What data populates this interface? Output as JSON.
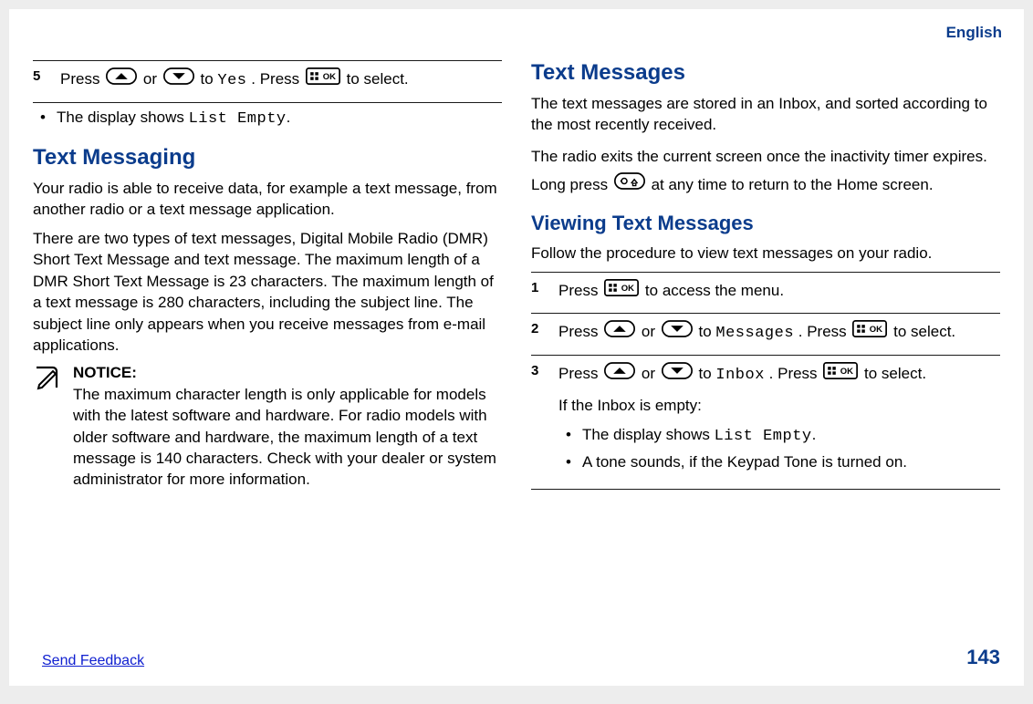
{
  "lang": "English",
  "footer": {
    "feedback": "Send Feedback",
    "page": "143"
  },
  "left": {
    "step5": {
      "num": "5",
      "t1": "Press ",
      "t2": " or ",
      "t3": " to ",
      "yes": "Yes",
      "t4": ". Press ",
      "t5": " to select."
    },
    "bullet1_a": "The display shows ",
    "bullet1_code": "List Empty",
    "bullet1_b": ".",
    "h2": "Text Messaging",
    "p1": "Your radio is able to receive data, for example a text message, from another radio or a text message application.",
    "p2": "There are two types of text messages, Digital Mobile Radio (DMR) Short Text Message and text message. The maximum length of a DMR Short Text Message is 23 characters. The maximum length of a text message is 280 characters, including the subject line. The subject line only appears when you receive messages from e-mail applications.",
    "notice_title": "NOTICE:",
    "notice_body": "The maximum character length is only applicable for models with the latest software and hardware. For radio models with older software and hardware, the maximum length of a text message is 140 characters. Check with your dealer or system administrator for more information."
  },
  "right": {
    "h2": "Text Messages",
    "p1": "The text messages are stored in an Inbox, and sorted according to the most recently received.",
    "p2a": "The radio exits the current screen once the inactivity timer expires. Long press ",
    "p2b": " at any time to return to the Home screen.",
    "h3": "Viewing Text Messages",
    "p3": "Follow the procedure to view text messages on your radio.",
    "step1": {
      "num": "1",
      "t1": "Press ",
      "t2": " to access the menu."
    },
    "step2": {
      "num": "2",
      "t1": "Press ",
      "t2": " or ",
      "t3": " to ",
      "code": "Messages",
      "t4": ". Press ",
      "t5": " to select."
    },
    "step3": {
      "num": "3",
      "t1": "Press ",
      "t2": " or ",
      "t3": " to ",
      "code": "Inbox",
      "t4": ". Press ",
      "t5": " to select.",
      "sub": "If the Inbox is empty:",
      "b1a": "The display shows ",
      "b1code": "List Empty",
      "b1b": ".",
      "b2": "A tone sounds, if the Keypad Tone is turned on."
    }
  }
}
